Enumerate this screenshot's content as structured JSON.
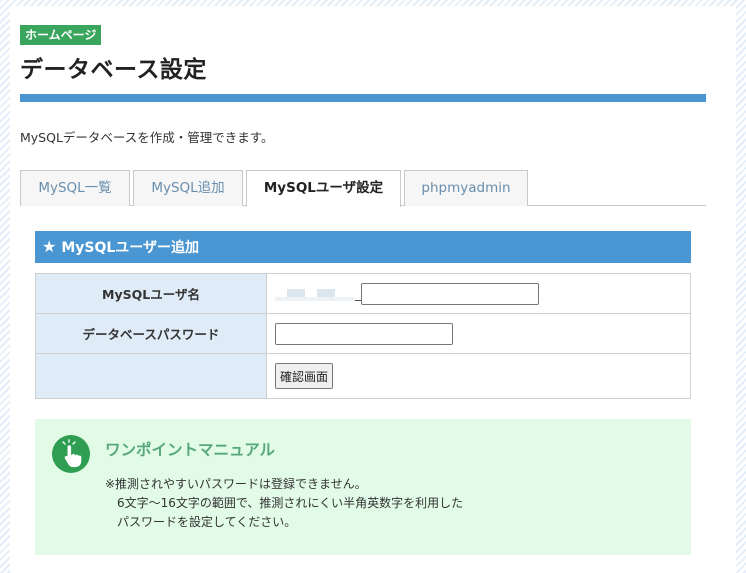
{
  "header": {
    "badge": "ホームページ",
    "title": "データベース設定"
  },
  "description": "MySQLデータベースを作成・管理できます。",
  "tabs": [
    {
      "label": "MySQL一覧",
      "active": false
    },
    {
      "label": "MySQL追加",
      "active": false
    },
    {
      "label": "MySQLユーザ設定",
      "active": true
    },
    {
      "label": "phpmyadmin",
      "active": false
    }
  ],
  "section": {
    "title": "MySQLユーザー追加"
  },
  "form": {
    "username_label": "MySQLユーザ名",
    "username_prefix_separator": "_",
    "username_value": "",
    "password_label": "データベースパスワード",
    "password_value": "",
    "confirm_button": "確認画面"
  },
  "tip": {
    "title": "ワンポイントマニュアル",
    "lines": [
      "※推測されやすいパスワードは登録できません。",
      "　6文字～16文字の範囲で、推測されにくい半角英数字を利用した",
      "　パスワードを設定してください。"
    ]
  },
  "colors": {
    "accent_blue": "#4a96d2",
    "badge_green": "#3aa55d",
    "tip_background": "#e1fbe6",
    "label_cell": "#dfebf6"
  }
}
